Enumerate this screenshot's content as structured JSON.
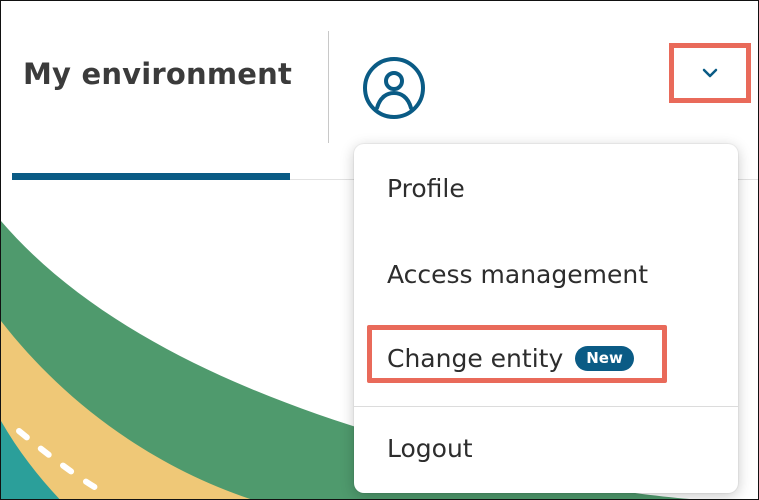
{
  "header": {
    "tab_title": "My environment",
    "avatar_icon": "user-circle-icon",
    "toggle_icon": "chevron-down-icon"
  },
  "menu": {
    "items": [
      {
        "label": "Profile"
      },
      {
        "label": "Access management"
      },
      {
        "label": "Change entity",
        "badge": "New"
      },
      {
        "label": "Logout"
      }
    ]
  },
  "colors": {
    "accent": "#0a5b85",
    "highlight": "#e96a5a",
    "green": "#4f9a6d",
    "sand": "#efc877",
    "teal": "#2b9f9a"
  }
}
